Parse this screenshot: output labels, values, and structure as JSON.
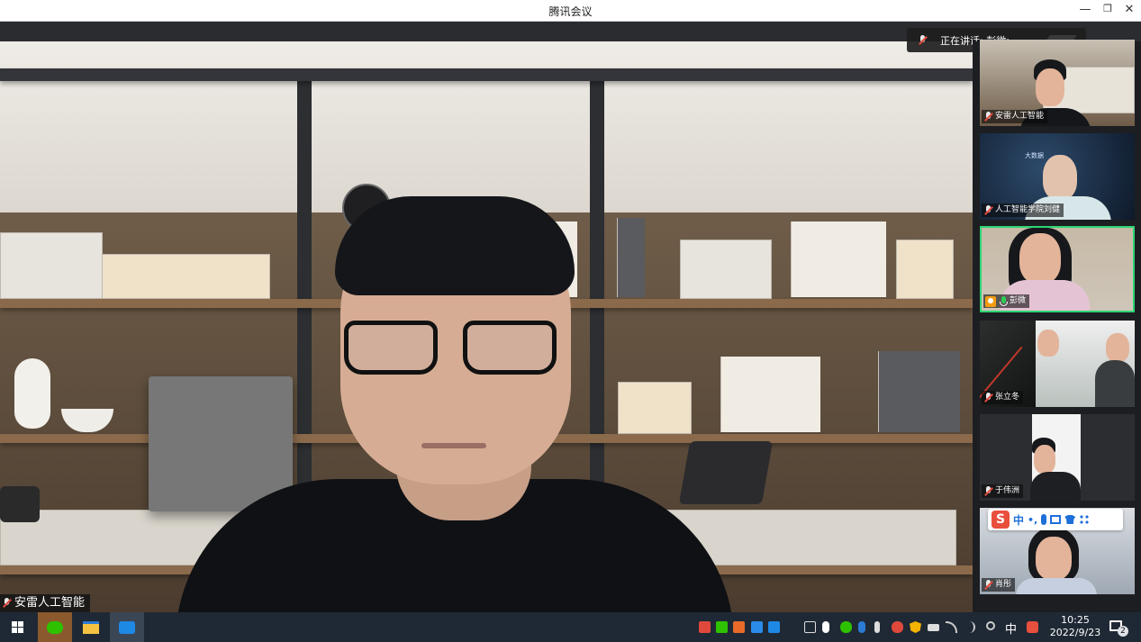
{
  "window": {
    "title": "腾讯会议",
    "minimize": "—",
    "restore": "❐",
    "close": "✕"
  },
  "speaking_indicator": {
    "text": "正在讲话: 彭微;"
  },
  "main_video": {
    "participant_name": "安雷人工智能"
  },
  "participants": [
    {
      "name": "安雷人工智能",
      "mic": "muted",
      "active": false
    },
    {
      "name": "人工智能学院刘健",
      "mic": "muted",
      "active": false,
      "overlay_text": "大数据"
    },
    {
      "name": "彭微",
      "mic": "on",
      "active": true,
      "host_icon": true
    },
    {
      "name": "张立冬",
      "mic": "muted",
      "active": false
    },
    {
      "name": "于伟洲",
      "mic": "muted",
      "active": false
    },
    {
      "name": "肖彤",
      "mic": "muted",
      "active": false
    }
  ],
  "ime_toolbar": {
    "logo": "S",
    "mode": "中",
    "punct": "•,"
  },
  "taskbar": {
    "apps": [
      "windows-start",
      "wechat",
      "file-explorer",
      "tencent-meeting"
    ],
    "tray_language": "中",
    "time": "10:25",
    "date": "2022/9/23",
    "notification_count": "2"
  },
  "colors": {
    "active_border": "#2ed573",
    "muted_slash": "#e0483c",
    "taskbar_bg": "#1f2935"
  }
}
